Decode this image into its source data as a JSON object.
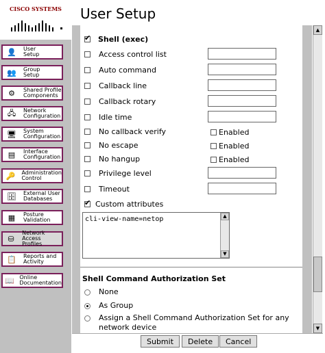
{
  "brand": {
    "logo_text": "Cisco Systems"
  },
  "page": {
    "title": "User Setup"
  },
  "nav": [
    {
      "label": "User\nSetup",
      "icon": "user-icon",
      "selected": false
    },
    {
      "label": "Group\nSetup",
      "icon": "group-icon",
      "selected": false
    },
    {
      "label": "Shared Profile\nComponents",
      "icon": "shared-profile-icon",
      "selected": false
    },
    {
      "label": "Network\nConfiguration",
      "icon": "network-icon",
      "selected": false
    },
    {
      "label": "System\nConfiguration",
      "icon": "system-icon",
      "selected": false
    },
    {
      "label": "Interface\nConfiguration",
      "icon": "interface-icon",
      "selected": false
    },
    {
      "label": "Administration\nControl",
      "icon": "admin-icon",
      "selected": false
    },
    {
      "label": "External User\nDatabases",
      "icon": "database-icon",
      "selected": false
    },
    {
      "label": "Posture\nValidation",
      "icon": "posture-icon",
      "selected": false
    },
    {
      "label": "Network Access\nProfiles",
      "icon": "access-profile-icon",
      "selected": true
    },
    {
      "label": "Reports and\nActivity",
      "icon": "reports-icon",
      "selected": false
    },
    {
      "label": "Online\nDocumentation",
      "icon": "docs-icon",
      "selected": false
    }
  ],
  "shell": {
    "header": "Shell (exec)",
    "header_checked": true,
    "rows": [
      {
        "label": "Access control list",
        "checked": false,
        "control": "text",
        "value": ""
      },
      {
        "label": "Auto command",
        "checked": false,
        "control": "text",
        "value": ""
      },
      {
        "label": "Callback line",
        "checked": false,
        "control": "text",
        "value": ""
      },
      {
        "label": "Callback rotary",
        "checked": false,
        "control": "text",
        "value": ""
      },
      {
        "label": "Idle time",
        "checked": false,
        "control": "text",
        "value": ""
      },
      {
        "label": "No callback verify",
        "checked": false,
        "control": "enabled",
        "enabled_label": "Enabled",
        "enabled_checked": false
      },
      {
        "label": "No escape",
        "checked": false,
        "control": "enabled",
        "enabled_label": "Enabled",
        "enabled_checked": false
      },
      {
        "label": "No hangup",
        "checked": false,
        "control": "enabled",
        "enabled_label": "Enabled",
        "enabled_checked": false
      },
      {
        "label": "Privilege level",
        "checked": false,
        "control": "text",
        "value": ""
      },
      {
        "label": "Timeout",
        "checked": false,
        "control": "text",
        "value": ""
      }
    ],
    "custom_attributes_label": "Custom attributes",
    "custom_attributes_checked": true,
    "custom_attributes_value": "cli-view-name=netop"
  },
  "authorization": {
    "heading": "Shell Command Authorization Set",
    "options": [
      {
        "label": "None",
        "selected": false
      },
      {
        "label": "As Group",
        "selected": true
      },
      {
        "label": "Assign a Shell Command Authorization Set for any network device",
        "selected": false
      }
    ]
  },
  "buttons": {
    "submit": "Submit",
    "delete": "Delete",
    "cancel": "Cancel"
  }
}
